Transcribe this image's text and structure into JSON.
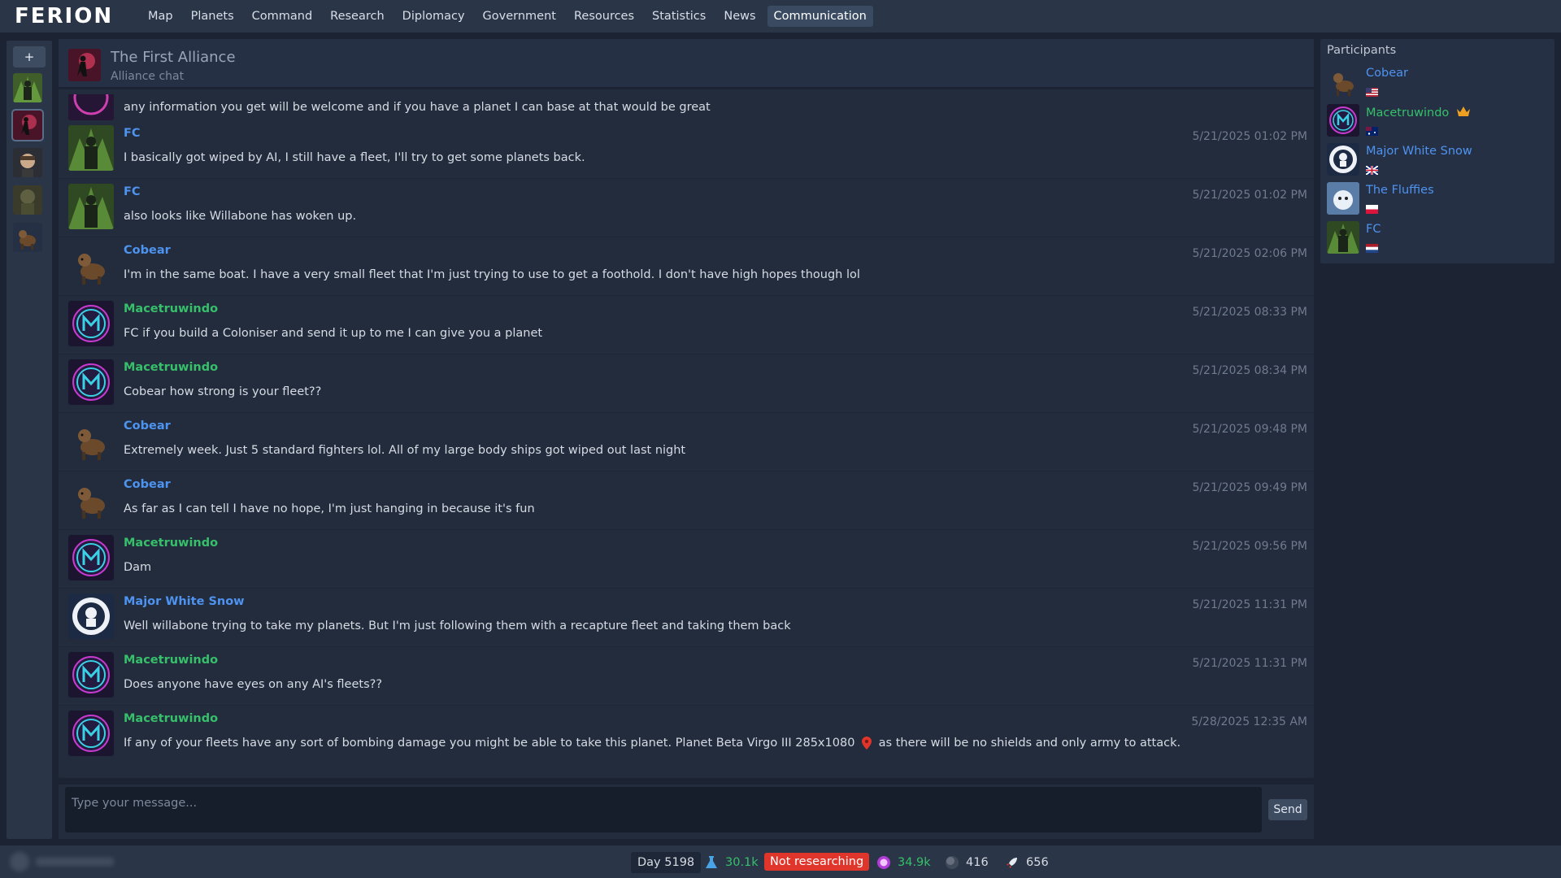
{
  "app": {
    "logo": "FERION"
  },
  "nav": {
    "items": [
      "Map",
      "Planets",
      "Command",
      "Research",
      "Diplomacy",
      "Government",
      "Resources",
      "Statistics",
      "News",
      "Communication"
    ],
    "active": "Communication"
  },
  "sidebar": {
    "new_chat_label": "+"
  },
  "chat": {
    "title": "The First Alliance",
    "subtitle": "Alliance chat",
    "partial_message": "any information you get will be welcome and if you have a planet I can base at that would be great",
    "messages": [
      {
        "author": "FC",
        "time": "5/21/2025 01:02 PM",
        "text": "I basically got wiped by AI, I still have a fleet, I'll try to get some planets back."
      },
      {
        "author": "FC",
        "time": "5/21/2025 01:02 PM",
        "text": "also looks like Willabone has woken up."
      },
      {
        "author": "Cobear",
        "time": "5/21/2025 02:06 PM",
        "text": "I'm in the same boat. I have a very small fleet that I'm just trying to use to get a foothold. I don't have high hopes though lol"
      },
      {
        "author": "Macetruwindo",
        "time": "5/21/2025 08:33 PM",
        "text": "FC if you build a Coloniser and send it up to me I can give you a planet"
      },
      {
        "author": "Macetruwindo",
        "time": "5/21/2025 08:34 PM",
        "text": "Cobear how strong is your fleet??"
      },
      {
        "author": "Cobear",
        "time": "5/21/2025 09:48 PM",
        "text": "Extremely week. Just 5 standard fighters lol. All of my large body ships got wiped out last night"
      },
      {
        "author": "Cobear",
        "time": "5/21/2025 09:49 PM",
        "text": "As far as I can tell I have no hope, I'm just hanging in because it's fun"
      },
      {
        "author": "Macetruwindo",
        "time": "5/21/2025 09:56 PM",
        "text": "Dam"
      },
      {
        "author": "Major White Snow",
        "time": "5/21/2025 11:31 PM",
        "text": "Well willabone trying to take my planets. But I'm just following them with a recapture fleet and taking them back"
      },
      {
        "author": "Macetruwindo",
        "time": "5/21/2025 11:31 PM",
        "text": "Does anyone have eyes on any AI's fleets??"
      },
      {
        "author": "Macetruwindo",
        "time": "5/28/2025 12:35 AM",
        "text_before": "If any of your fleets have any sort of bombing damage you might be able to take this planet. Planet Beta Virgo III 285x1080",
        "text_after": "as there will be no shields and only army to attack."
      }
    ]
  },
  "composer": {
    "placeholder": "Type your message...",
    "send_label": "Send"
  },
  "participants": {
    "title": "Participants",
    "list": [
      {
        "name": "Cobear",
        "flag": "us"
      },
      {
        "name": "Macetruwindo",
        "flag": "au",
        "crown": true
      },
      {
        "name": "Major White Snow",
        "flag": "gb"
      },
      {
        "name": "The Fluffies",
        "flag": "pl"
      },
      {
        "name": "FC",
        "flag": "nl"
      }
    ]
  },
  "status": {
    "day": "Day 5198",
    "research_points": "30.1k",
    "research_status": "Not researching",
    "influence": "34.9k",
    "planets": "416",
    "ships": "656"
  },
  "colors": {
    "blue_name": "#4e93f0",
    "green_name": "#36c06a",
    "alert_red": "#e0352b"
  }
}
